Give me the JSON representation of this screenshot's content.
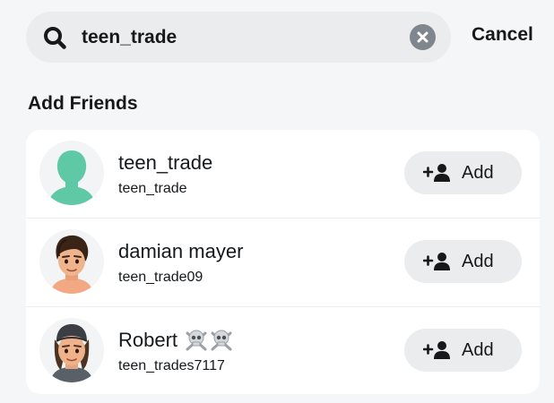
{
  "search": {
    "query": "teen_trade",
    "icon": "search-icon",
    "clear_icon": "close-circle-icon",
    "cancel_label": "Cancel"
  },
  "section": {
    "title": "Add Friends"
  },
  "results": [
    {
      "display_name": "teen_trade",
      "username": "teen_trade",
      "avatar": "default-silhouette-avatar",
      "add_label": "Add"
    },
    {
      "display_name": "damian mayer",
      "username": "teen_trade09",
      "avatar": "bitmoji-avatar",
      "add_label": "Add"
    },
    {
      "display_name": "Robert ☠️☠️",
      "display_name_text": "Robert",
      "username": "teen_trades7117",
      "avatar": "bitmoji-avatar",
      "add_label": "Add"
    }
  ],
  "colors": {
    "background": "#f5f6f8",
    "search_bar": "#ebecee",
    "card": "#ffffff",
    "button": "#ebecee",
    "text": "#16191c",
    "silhouette": "#5ec9a4"
  }
}
